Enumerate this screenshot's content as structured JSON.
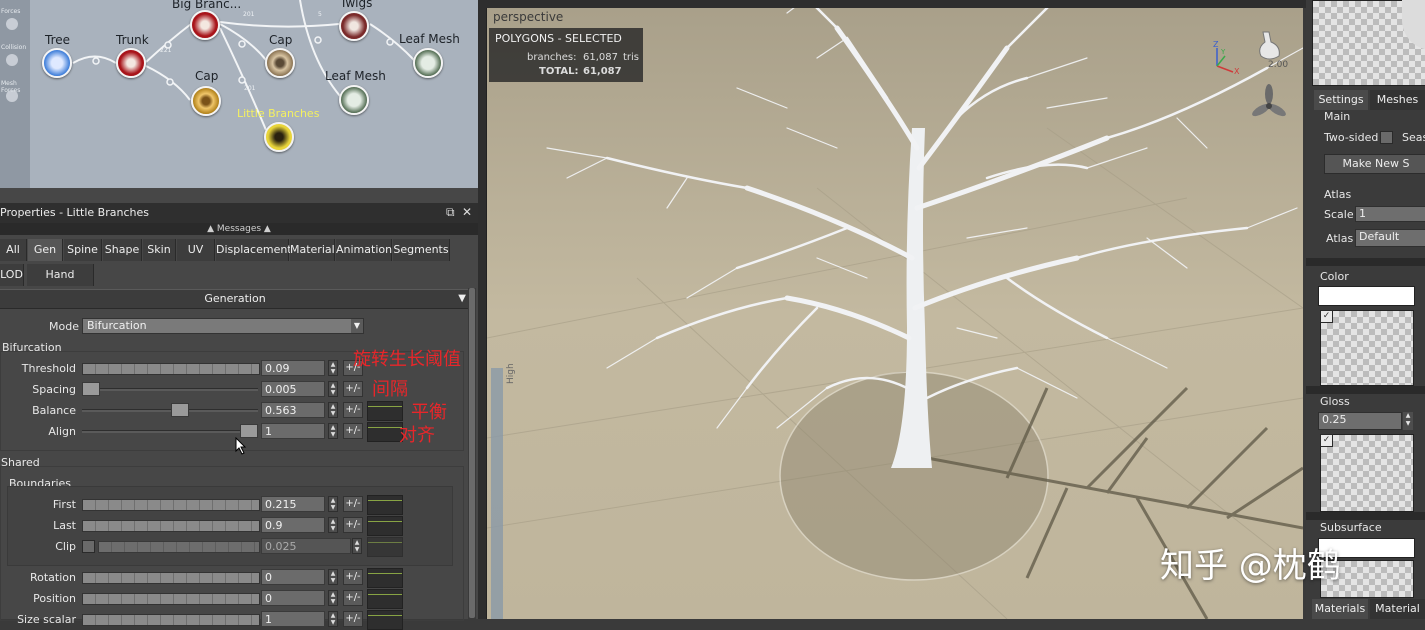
{
  "graph": {
    "side_labels": [
      "Forces",
      "Collision",
      "Mesh Forces"
    ],
    "nodes": {
      "tree": "Tree",
      "trunk": "Trunk",
      "big_branches": "Big Branc...",
      "cap1": "Cap",
      "cap2": "Cap",
      "twigs": "Twigs",
      "leaf_mesh1": "Leaf Mesh",
      "leaf_mesh2": "Leaf Mesh",
      "little_branches": "Little Branches"
    },
    "wire_labels": [
      "201",
      "221",
      "5",
      "201"
    ]
  },
  "properties": {
    "title": "Properties - Little Branches",
    "messages": "Messages",
    "tabs_row1": [
      "All",
      "Gen",
      "Spine",
      "Shape",
      "Skin",
      "UV",
      "Displacement",
      "Material",
      "Animation",
      "Segments"
    ],
    "tabs_row2": [
      "LOD",
      "Hand Drawn"
    ],
    "active_tab": "Gen",
    "section": "Generation",
    "mode_label": "Mode",
    "mode_value": "Bifurcation",
    "bifurcation": {
      "title": "Bifurcation",
      "threshold": {
        "label": "Threshold",
        "value": "0.09"
      },
      "spacing": {
        "label": "Spacing",
        "value": "0.005"
      },
      "balance": {
        "label": "Balance",
        "value": "0.563"
      },
      "align": {
        "label": "Align",
        "value": "1"
      }
    },
    "pm": "+/-",
    "shared": {
      "title": "Shared",
      "boundaries": "Boundaries",
      "first": {
        "label": "First",
        "value": "0.215"
      },
      "last": {
        "label": "Last",
        "value": "0.9"
      },
      "clip": {
        "label": "Clip",
        "value": "0.025"
      },
      "rotation": {
        "label": "Rotation",
        "value": "0"
      },
      "position": {
        "label": "Position",
        "value": "0"
      },
      "size_scalar": {
        "label": "Size scalar",
        "value": "1"
      }
    },
    "annotations": {
      "threshold": "旋转生长阈值",
      "spacing": "间隔",
      "balance": "平衡",
      "align": "对齐"
    }
  },
  "viewport": {
    "title": "perspective",
    "polygons_header": "POLYGONS - SELECTED",
    "branches_label": "branches:",
    "branches_value": "61,087",
    "branches_unit": "tris",
    "total_label": "TOTAL:",
    "total_value": "61,087",
    "zoom": "2.00",
    "axis_z": "Z",
    "axis_y": "Y",
    "axis_x": "X",
    "ruler_label": "High"
  },
  "right_panel": {
    "tabs": [
      "Settings",
      "Meshes"
    ],
    "main": "Main",
    "two_sided": "Two-sided",
    "seams": "Seas",
    "make_new": "Make New S",
    "atlas_title": "Atlas",
    "scale_label": "Scale",
    "scale_value": "1",
    "atlas_label": "Atlas",
    "atlas_value": "Default",
    "color": "Color",
    "gloss": "Gloss",
    "gloss_value": "0.25",
    "subsurface": "Subsurface",
    "bottom_tabs": [
      "Materials",
      "Material"
    ]
  },
  "watermark": "知乎 @枕鹤"
}
